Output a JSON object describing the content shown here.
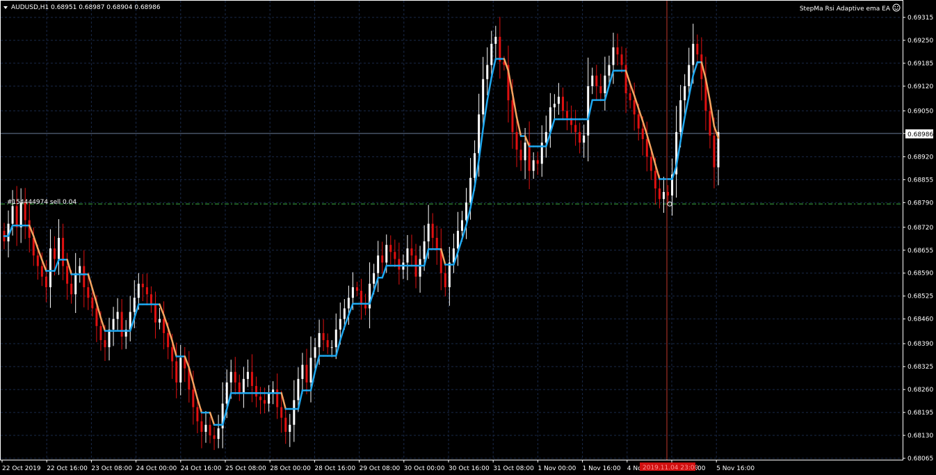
{
  "header": {
    "symbol_line": "AUDUSD,H1  0.68951 0.68987 0.68904 0.68986",
    "ea_name": "StepMa Rsi Adaptive ema EA"
  },
  "order_label": "#154444974 sell 0.04",
  "crosshair_time": "2019.11.04 23:00",
  "colors": {
    "background": "#000000",
    "grid": "#1a2a4a",
    "axis": "#ffffff",
    "bull": "#ffffff",
    "bear": "#e01010",
    "stepma_up": "#1fa8f0",
    "stepma_down": "#f4a460",
    "order_line": "#3cb043",
    "crosshair": "#c0392b",
    "bid_line": "#6b7c99"
  },
  "chart_data": {
    "type": "candlestick",
    "symbol": "AUDUSD",
    "timeframe": "H1",
    "ohlc_header": {
      "open": 0.68951,
      "high": 0.68987,
      "low": 0.68904,
      "close": 0.68986
    },
    "ylim": [
      0.68065,
      0.69315
    ],
    "y_ticks": [
      "0.69315",
      "0.69250",
      "0.69185",
      "0.69120",
      "0.69050",
      "0.68986",
      "0.68920",
      "0.68855",
      "0.68790",
      "0.68720",
      "0.68655",
      "0.68590",
      "0.68525",
      "0.68460",
      "0.68390",
      "0.68325",
      "0.68260",
      "0.68195",
      "0.68130",
      "0.68065"
    ],
    "x_ticks": [
      "22 Oct 2019",
      "22 Oct 16:00",
      "23 Oct 08:00",
      "24 Oct 00:00",
      "24 Oct 16:00",
      "25 Oct 08:00",
      "28 Oct 00:00",
      "28 Oct 16:00",
      "29 Oct 08:00",
      "30 Oct 00:00",
      "30 Oct 16:00",
      "31 Oct 08:00",
      "1 Nov 00:00",
      "1 Nov 16:00",
      "4 No",
      ":00",
      "5 Nov 16:00"
    ],
    "current_price": 0.68986,
    "order_price": 0.68786,
    "closes": [
      0.6868,
      0.6873,
      0.6878,
      0.6872,
      0.6879,
      0.6874,
      0.6869,
      0.6864,
      0.6861,
      0.6858,
      0.6855,
      0.6866,
      0.6863,
      0.6869,
      0.6861,
      0.6856,
      0.6853,
      0.6859,
      0.6861,
      0.6855,
      0.6852,
      0.6849,
      0.6844,
      0.684,
      0.6838,
      0.6843,
      0.6846,
      0.6848,
      0.6841,
      0.6843,
      0.6848,
      0.6852,
      0.6856,
      0.6855,
      0.6853,
      0.685,
      0.6845,
      0.6846,
      0.6842,
      0.6838,
      0.6834,
      0.6828,
      0.6835,
      0.6832,
      0.6826,
      0.6821,
      0.6817,
      0.6814,
      0.6816,
      0.6813,
      0.6812,
      0.6815,
      0.6822,
      0.6828,
      0.6831,
      0.6828,
      0.6825,
      0.6829,
      0.6831,
      0.6827,
      0.6824,
      0.6823,
      0.6822,
      0.6825,
      0.6826,
      0.6821,
      0.6818,
      0.6814,
      0.6816,
      0.6823,
      0.6829,
      0.6833,
      0.6828,
      0.6835,
      0.6838,
      0.6842,
      0.684,
      0.6838,
      0.6838,
      0.6843,
      0.6846,
      0.6849,
      0.6852,
      0.6855,
      0.6854,
      0.685,
      0.6849,
      0.6856,
      0.6859,
      0.6864,
      0.6862,
      0.6867,
      0.6865,
      0.6863,
      0.686,
      0.6862,
      0.6866,
      0.6864,
      0.6858,
      0.6863,
      0.6868,
      0.6873,
      0.6869,
      0.6866,
      0.6859,
      0.6855,
      0.6862,
      0.6866,
      0.6871,
      0.6874,
      0.6879,
      0.6886,
      0.6893,
      0.6904,
      0.6914,
      0.6918,
      0.6924,
      0.6926,
      0.6919,
      0.6918,
      0.6908,
      0.6899,
      0.6894,
      0.6891,
      0.6896,
      0.6888,
      0.6891,
      0.689,
      0.6896,
      0.6899,
      0.6906,
      0.6907,
      0.6909,
      0.6905,
      0.6903,
      0.6901,
      0.6899,
      0.6896,
      0.6898,
      0.6912,
      0.6915,
      0.6912,
      0.691,
      0.6915,
      0.6918,
      0.6923,
      0.6921,
      0.6918,
      0.691,
      0.6908,
      0.6904,
      0.69,
      0.6897,
      0.6892,
      0.6888,
      0.6883,
      0.688,
      0.6882,
      0.6881,
      0.6887,
      0.6899,
      0.6908,
      0.6912,
      0.6918,
      0.6924,
      0.6921,
      0.6914,
      0.6905,
      0.6898,
      0.6889,
      0.6899
    ]
  }
}
